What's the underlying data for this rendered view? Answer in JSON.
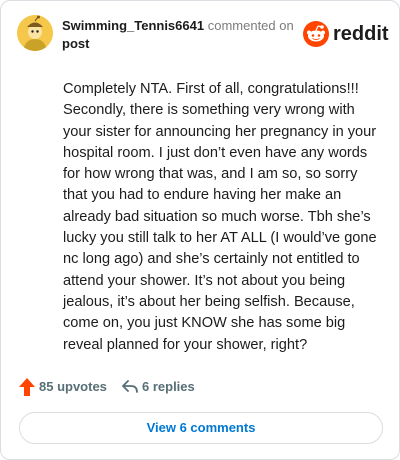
{
  "header": {
    "username": "Swimming_Tennis6641",
    "action_text": "commented on",
    "target_text": "post",
    "logo_text": "reddit"
  },
  "comment": {
    "body": "Completely NTA. First of all, congratulations!!! Secondly, there is something very wrong with your sister for announcing her pregnancy in your hospital room. I just don’t even have any words for how wrong that was, and I am so, so sorry that you had to endure having her make an already bad situation so much worse. Tbh she’s lucky you still talk to her AT ALL (I would’ve gone nc long ago) and she’s certainly not entitled to attend your shower. It’s not about you being jealous, it’s about her being selfish. Because, come on, you just KNOW she has some big reveal planned for your shower, right?"
  },
  "actions": {
    "upvotes_label": "85 upvotes",
    "replies_label": "6 replies"
  },
  "view_button_label": "View 6 comments",
  "colors": {
    "brand": "#ff4500",
    "link": "#0079d3",
    "meta": "#576f76",
    "avatar": "#f5c84c"
  }
}
